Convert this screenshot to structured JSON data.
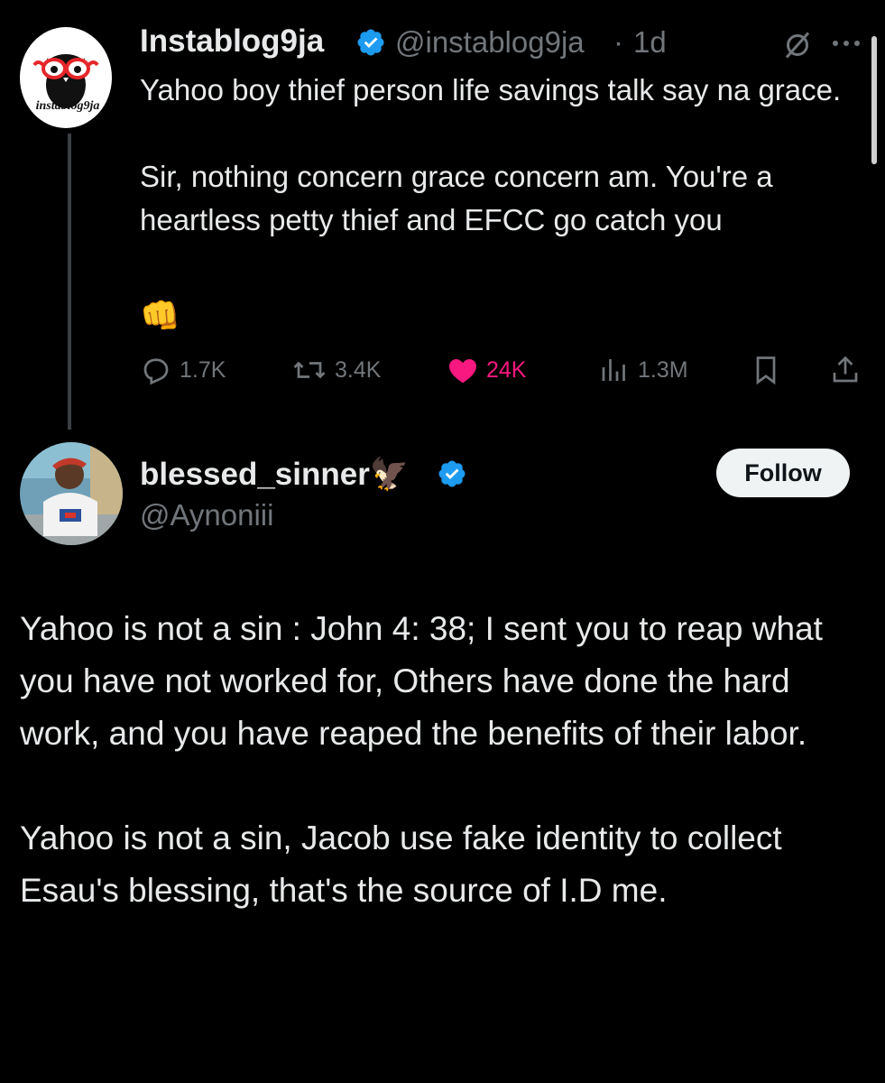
{
  "tweet": {
    "author_name": "Instablog9ja",
    "handle": "@instablog9ja",
    "separator": "·",
    "time": "1d",
    "logo_text": "instablog9ja",
    "text": "Yahoo boy thief person life savings talk say na grace.\n\nSir, nothing concern grace concern am. You're a heartless petty thief and EFCC go catch you",
    "emoji": "👊",
    "stats": {
      "replies": "1.7K",
      "reposts": "3.4K",
      "likes": "24K",
      "views": "1.3M"
    }
  },
  "reply": {
    "author_name": "blessed_sinner🦅",
    "handle": "@Aynoniii",
    "follow_label": "Follow",
    "text": "Yahoo is not a sin : John 4: 38; I sent you to reap what you have not worked for, Others have done the hard work, and you have reaped the benefits of their labor.\n\nYahoo is not a sin, Jacob use fake identity to collect Esau's blessing, that's the source of I.D me."
  },
  "colors": {
    "background": "#000000",
    "text": "#e7e9ea",
    "secondary": "#71767b",
    "verified": "#1d9bf0",
    "like": "#f91880"
  }
}
